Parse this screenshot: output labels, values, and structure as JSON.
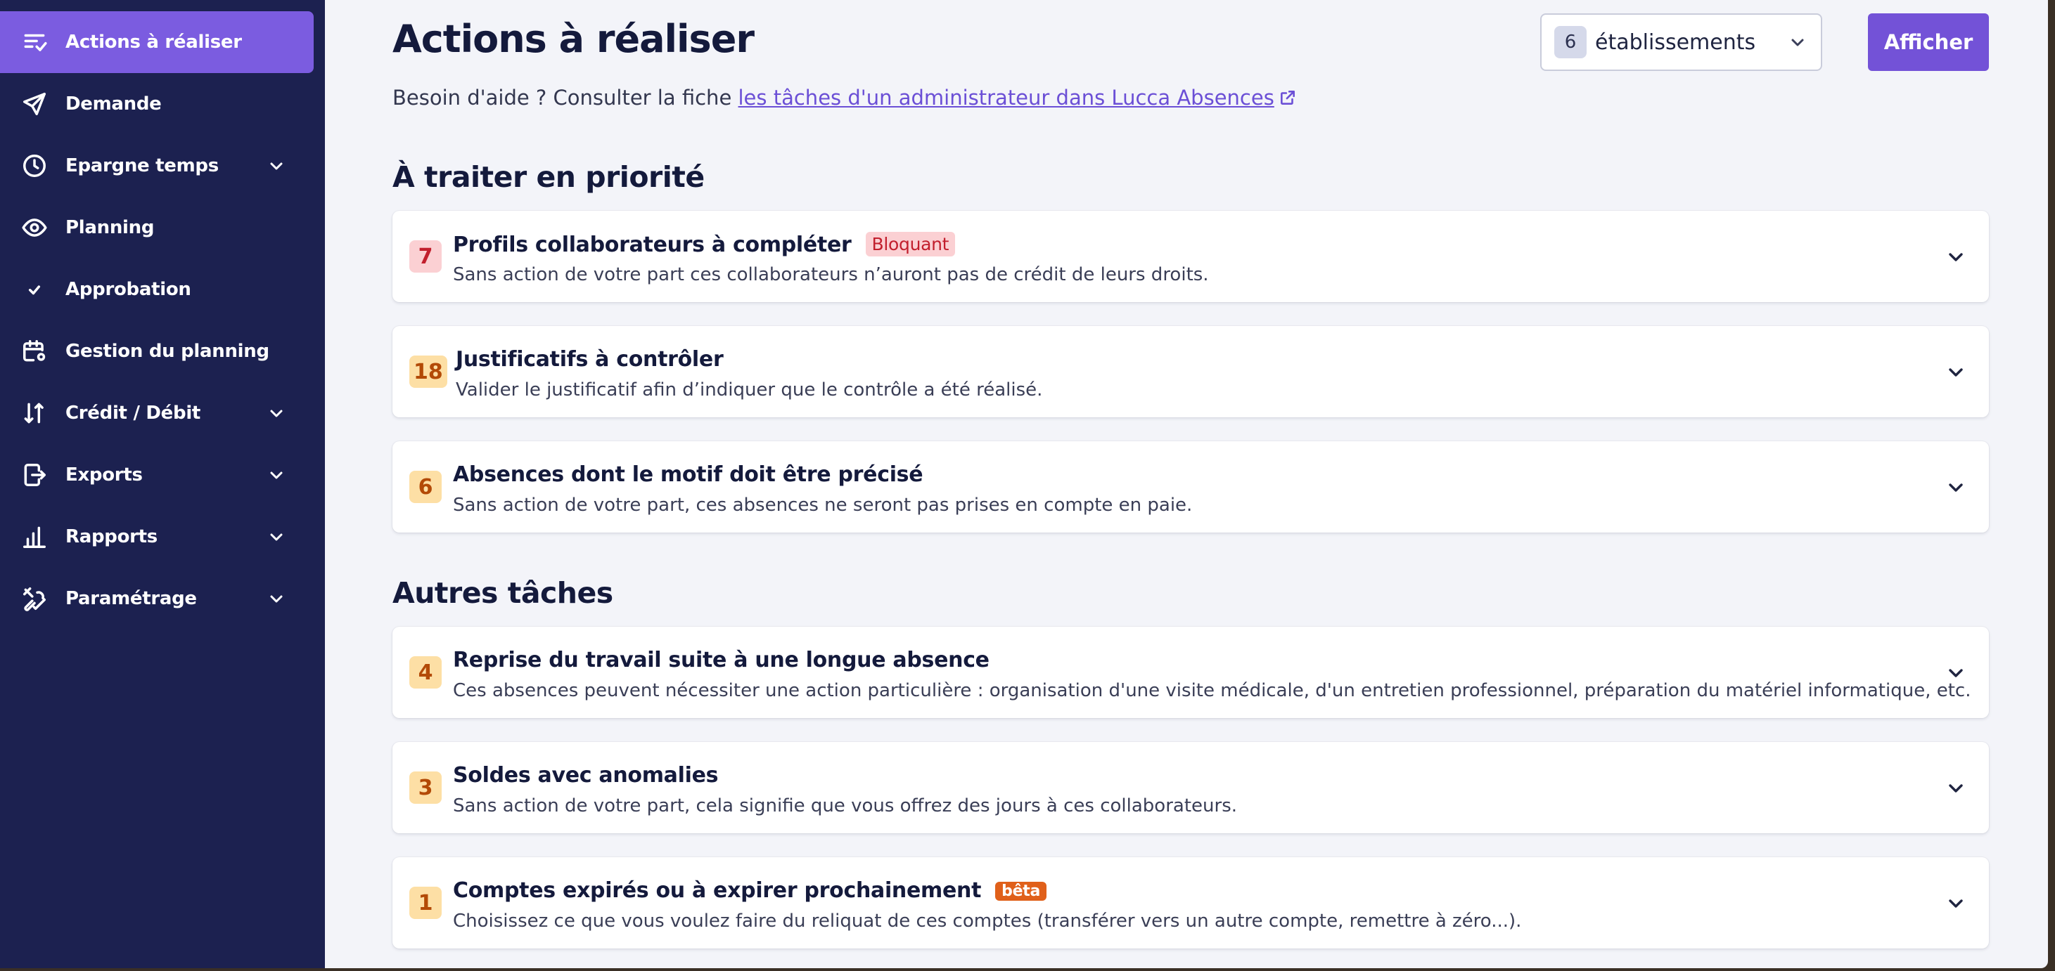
{
  "sidebar": {
    "items": [
      {
        "label": "Actions à réaliser",
        "icon": "tasks-icon",
        "active": true
      },
      {
        "label": "Demande",
        "icon": "send-icon"
      },
      {
        "label": "Epargne temps",
        "icon": "clock-icon",
        "expandable": true
      },
      {
        "label": "Planning",
        "icon": "eye-icon"
      },
      {
        "label": "Approbation",
        "icon": "check-icon"
      },
      {
        "label": "Gestion du planning",
        "icon": "calendar-settings-icon"
      },
      {
        "label": "Crédit / Débit",
        "icon": "sort-arrows-icon",
        "expandable": true
      },
      {
        "label": "Exports",
        "icon": "export-icon",
        "expandable": true
      },
      {
        "label": "Rapports",
        "icon": "bar-chart-icon",
        "expandable": true
      },
      {
        "label": "Paramétrage",
        "icon": "tools-icon",
        "expandable": true
      }
    ]
  },
  "header": {
    "title": "Actions à réaliser",
    "help_prefix": "Besoin d'aide ? Consulter la fiche ",
    "help_link": "les tâches d'un administrateur dans Lucca Absences",
    "establishment_count": "6",
    "establishment_label": "établissements",
    "show_button": "Afficher"
  },
  "sections": {
    "priority_title": "À traiter en priorité",
    "others_title": "Autres tâches"
  },
  "priority_tasks": [
    {
      "count": "7",
      "title": "Profils collaborateurs à compléter",
      "tag": "Bloquant",
      "description": "Sans action de votre part ces collaborateurs n’auront pas de crédit de leurs droits."
    },
    {
      "count": "18",
      "title": "Justificatifs à contrôler",
      "description": "Valider le justificatif afin d’indiquer que le contrôle a été réalisé."
    },
    {
      "count": "6",
      "title": "Absences dont le motif doit être précisé",
      "description": "Sans action de votre part, ces absences ne seront pas prises en compte en paie."
    }
  ],
  "other_tasks": [
    {
      "count": "4",
      "title": "Reprise du travail suite à une longue absence",
      "description": "Ces absences peuvent nécessiter une action particulière : organisation d'une visite médicale, d'un entretien professionnel, préparation du matériel informatique, etc."
    },
    {
      "count": "3",
      "title": "Soldes avec anomalies",
      "description": "Sans action de votre part, cela signifie que vous offrez des jours à ces collaborateurs."
    },
    {
      "count": "1",
      "title": "Comptes expirés ou à expirer prochainement",
      "tag": "bêta",
      "description": "Choisissez ce que vous voulez faire du reliquat de ces comptes (transférer vers un autre compte, remettre à zéro...)."
    }
  ],
  "colors": {
    "sidebar_bg": "#1c2150",
    "accent": "#7352d7",
    "badge_red_bg": "#fbd0d3",
    "badge_orange_bg": "#fddfa5",
    "beta_tag": "#e0601a"
  }
}
